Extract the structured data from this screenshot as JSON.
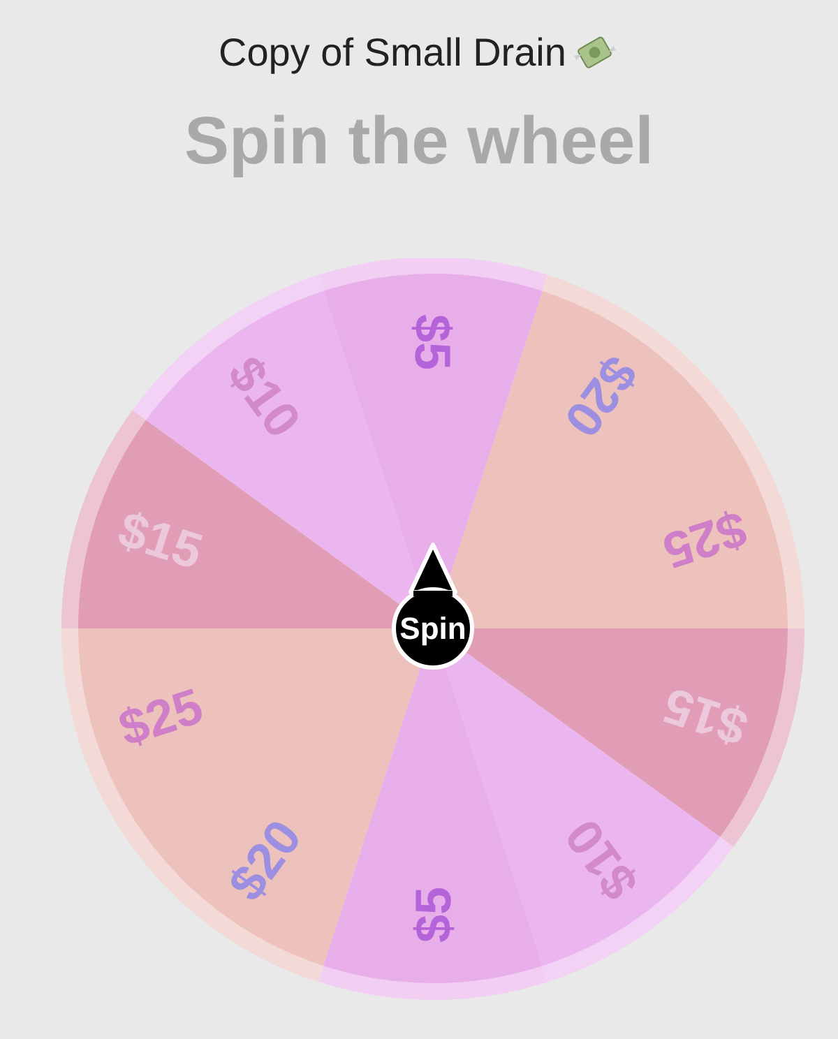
{
  "title": "Copy of Small Drain",
  "heading": "Spin the wheel",
  "wheel": {
    "segments": [
      {
        "color": "#e8aeea",
        "label": {
          "text": "$5",
          "color": "#b463d8"
        }
      },
      {
        "color": "#edc1bc",
        "label": {
          "text": "$20",
          "color": "#9c8ee0"
        }
      },
      {
        "color": "#edc1bc",
        "label": {
          "text": "$25",
          "color": "#cf7ec8"
        }
      },
      {
        "color": "#e19db6",
        "label": {
          "text": "$15",
          "color": "#ecc8dc"
        }
      },
      {
        "color": "#ebb6ef",
        "label": {
          "text": "$10",
          "color": "#d38ac8"
        }
      },
      {
        "color": "#e8aeea",
        "label": {
          "text": "$5",
          "color": "#b463d8"
        }
      },
      {
        "color": "#edc1bc",
        "label": {
          "text": "$20",
          "color": "#9c8ee0"
        }
      },
      {
        "color": "#edc1bc",
        "label": {
          "text": "$25",
          "color": "#cf7ec8"
        }
      },
      {
        "color": "#e19db6",
        "label": {
          "text": "$15",
          "color": "#ecc8dc"
        }
      },
      {
        "color": "#ebb6ef",
        "label": {
          "text": "$10",
          "color": "#d38ac8"
        }
      }
    ],
    "button": "Spin"
  }
}
